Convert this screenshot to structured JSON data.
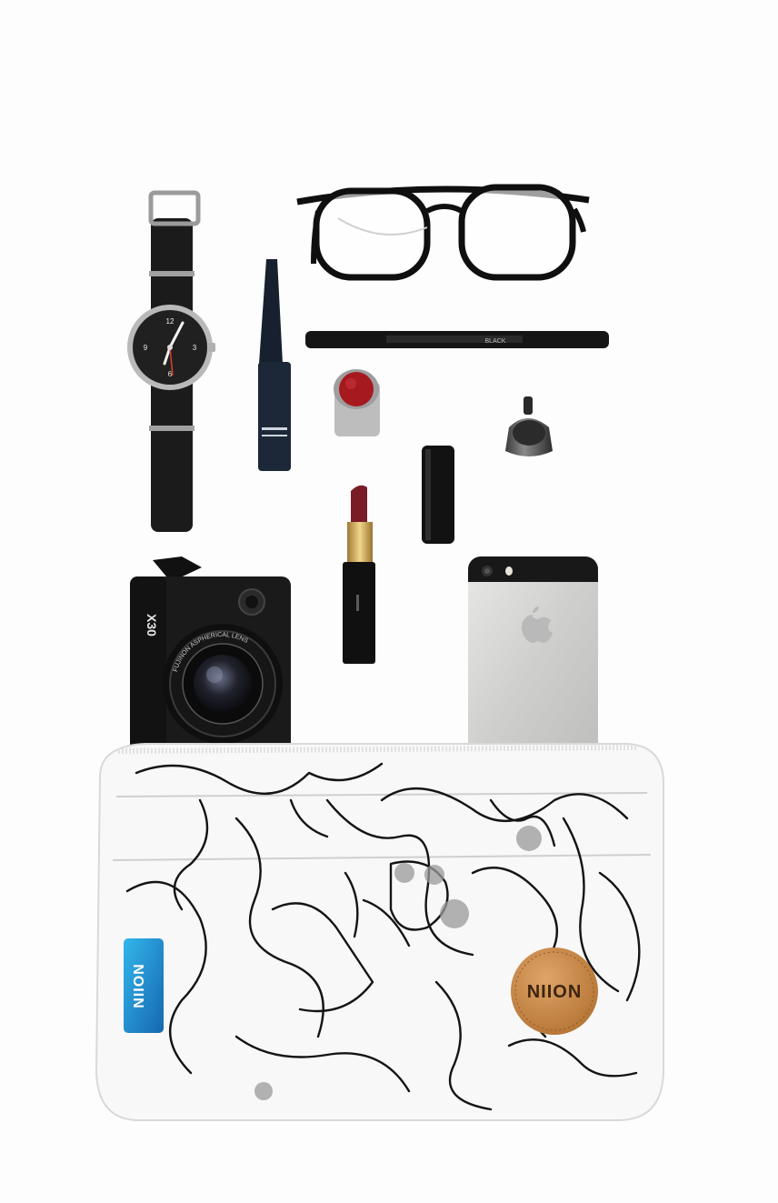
{
  "scene": {
    "background": "#fdfdfd",
    "items": [
      "wristwatch",
      "eyeglasses",
      "liquid-eyeliner",
      "eyeliner-pencil",
      "red-lipstick",
      "nail-polish",
      "black-lipstick",
      "gold-lipstick",
      "smartphone",
      "camera",
      "printed-pouch"
    ]
  },
  "watch": {
    "icon": "wristwatch-icon",
    "numerals": [
      "12",
      "3",
      "6",
      "9"
    ]
  },
  "camera": {
    "model_label": "X30",
    "lens_text": "FUJINON ASPHERICAL LENS"
  },
  "pencil": {
    "label": "BLACK"
  },
  "pouch": {
    "blue_tag": "NIION",
    "leather_patch": "NIION",
    "colors": {
      "tag": "#1d8fd1",
      "patch": "#c98a4b"
    }
  }
}
